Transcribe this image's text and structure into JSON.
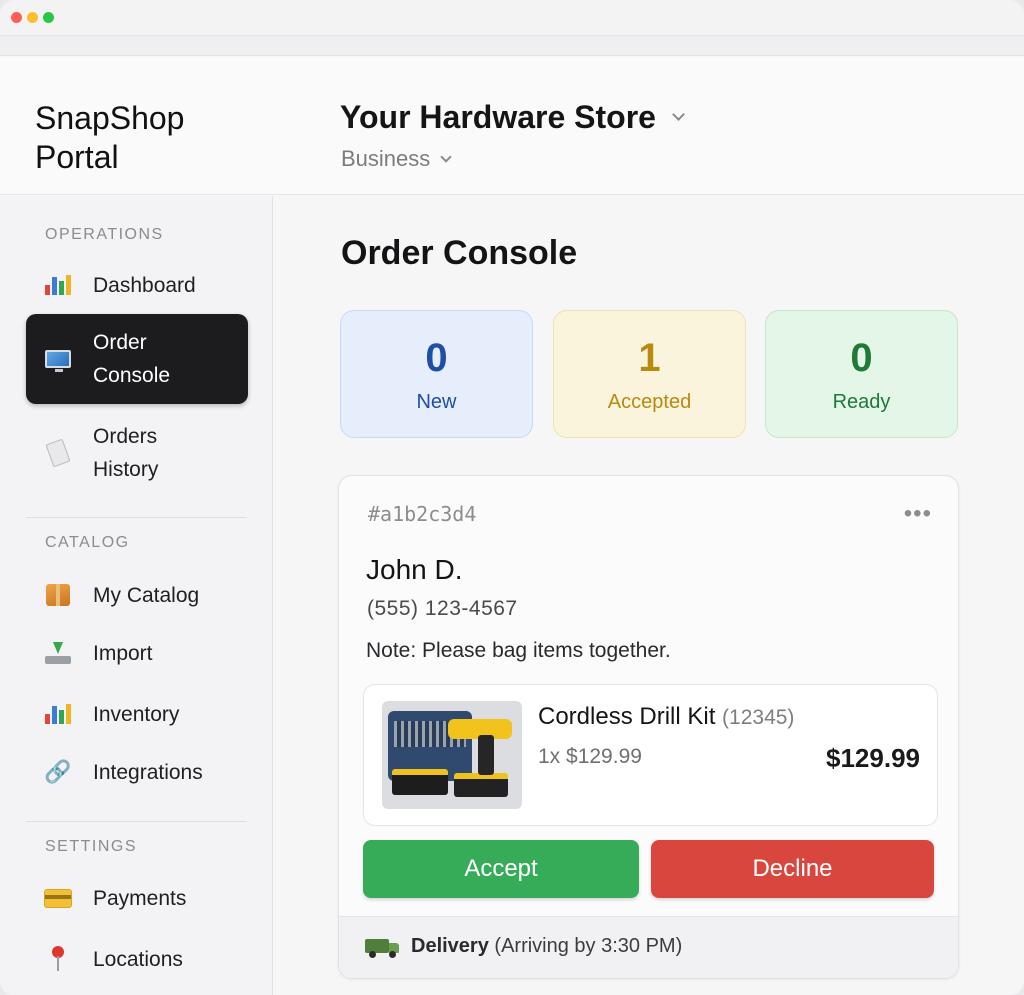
{
  "header": {
    "brand": "SnapShop Portal",
    "store_name": "Your Hardware Store",
    "account_type": "Business"
  },
  "sidebar": {
    "sections": [
      {
        "label": "OPERATIONS",
        "items": [
          {
            "label": "Dashboard",
            "icon": "bar-chart-icon",
            "active": false
          },
          {
            "label": "Order Console",
            "icon": "monitor-icon",
            "active": true
          },
          {
            "label": "Orders History",
            "icon": "receipt-icon",
            "active": false
          }
        ]
      },
      {
        "label": "CATALOG",
        "items": [
          {
            "label": "My Catalog",
            "icon": "package-icon",
            "active": false
          },
          {
            "label": "Import",
            "icon": "inbox-tray-icon",
            "active": false
          },
          {
            "label": "Inventory",
            "icon": "bar-chart-icon",
            "active": false
          },
          {
            "label": "Integrations",
            "icon": "link-icon",
            "active": false
          }
        ]
      },
      {
        "label": "SETTINGS",
        "items": [
          {
            "label": "Payments",
            "icon": "credit-card-icon",
            "active": false
          },
          {
            "label": "Locations",
            "icon": "pin-icon",
            "active": false
          }
        ]
      }
    ]
  },
  "main": {
    "title": "Order Console",
    "stats": [
      {
        "value": "0",
        "label": "New",
        "color": "#1e4fa8"
      },
      {
        "value": "1",
        "label": "Accepted",
        "color": "#b98a10"
      },
      {
        "value": "0",
        "label": "Ready",
        "color": "#1f7a36"
      }
    ],
    "order": {
      "id": "#a1b2c3d4",
      "customer_name": "John D.",
      "phone": "(555) 123-4567",
      "note": "Note: Please bag items together.",
      "item": {
        "name": "Cordless Drill Kit",
        "sku": "(12345)",
        "qty_price": "1x $129.99",
        "total": "$129.99"
      },
      "accept_label": "Accept",
      "decline_label": "Decline",
      "delivery_label": "Delivery",
      "delivery_eta": "(Arriving by 3:30 PM)"
    }
  },
  "colors": {
    "accept": "#36ab58",
    "decline": "#d9463e",
    "active_nav": "#1c1c1f"
  }
}
